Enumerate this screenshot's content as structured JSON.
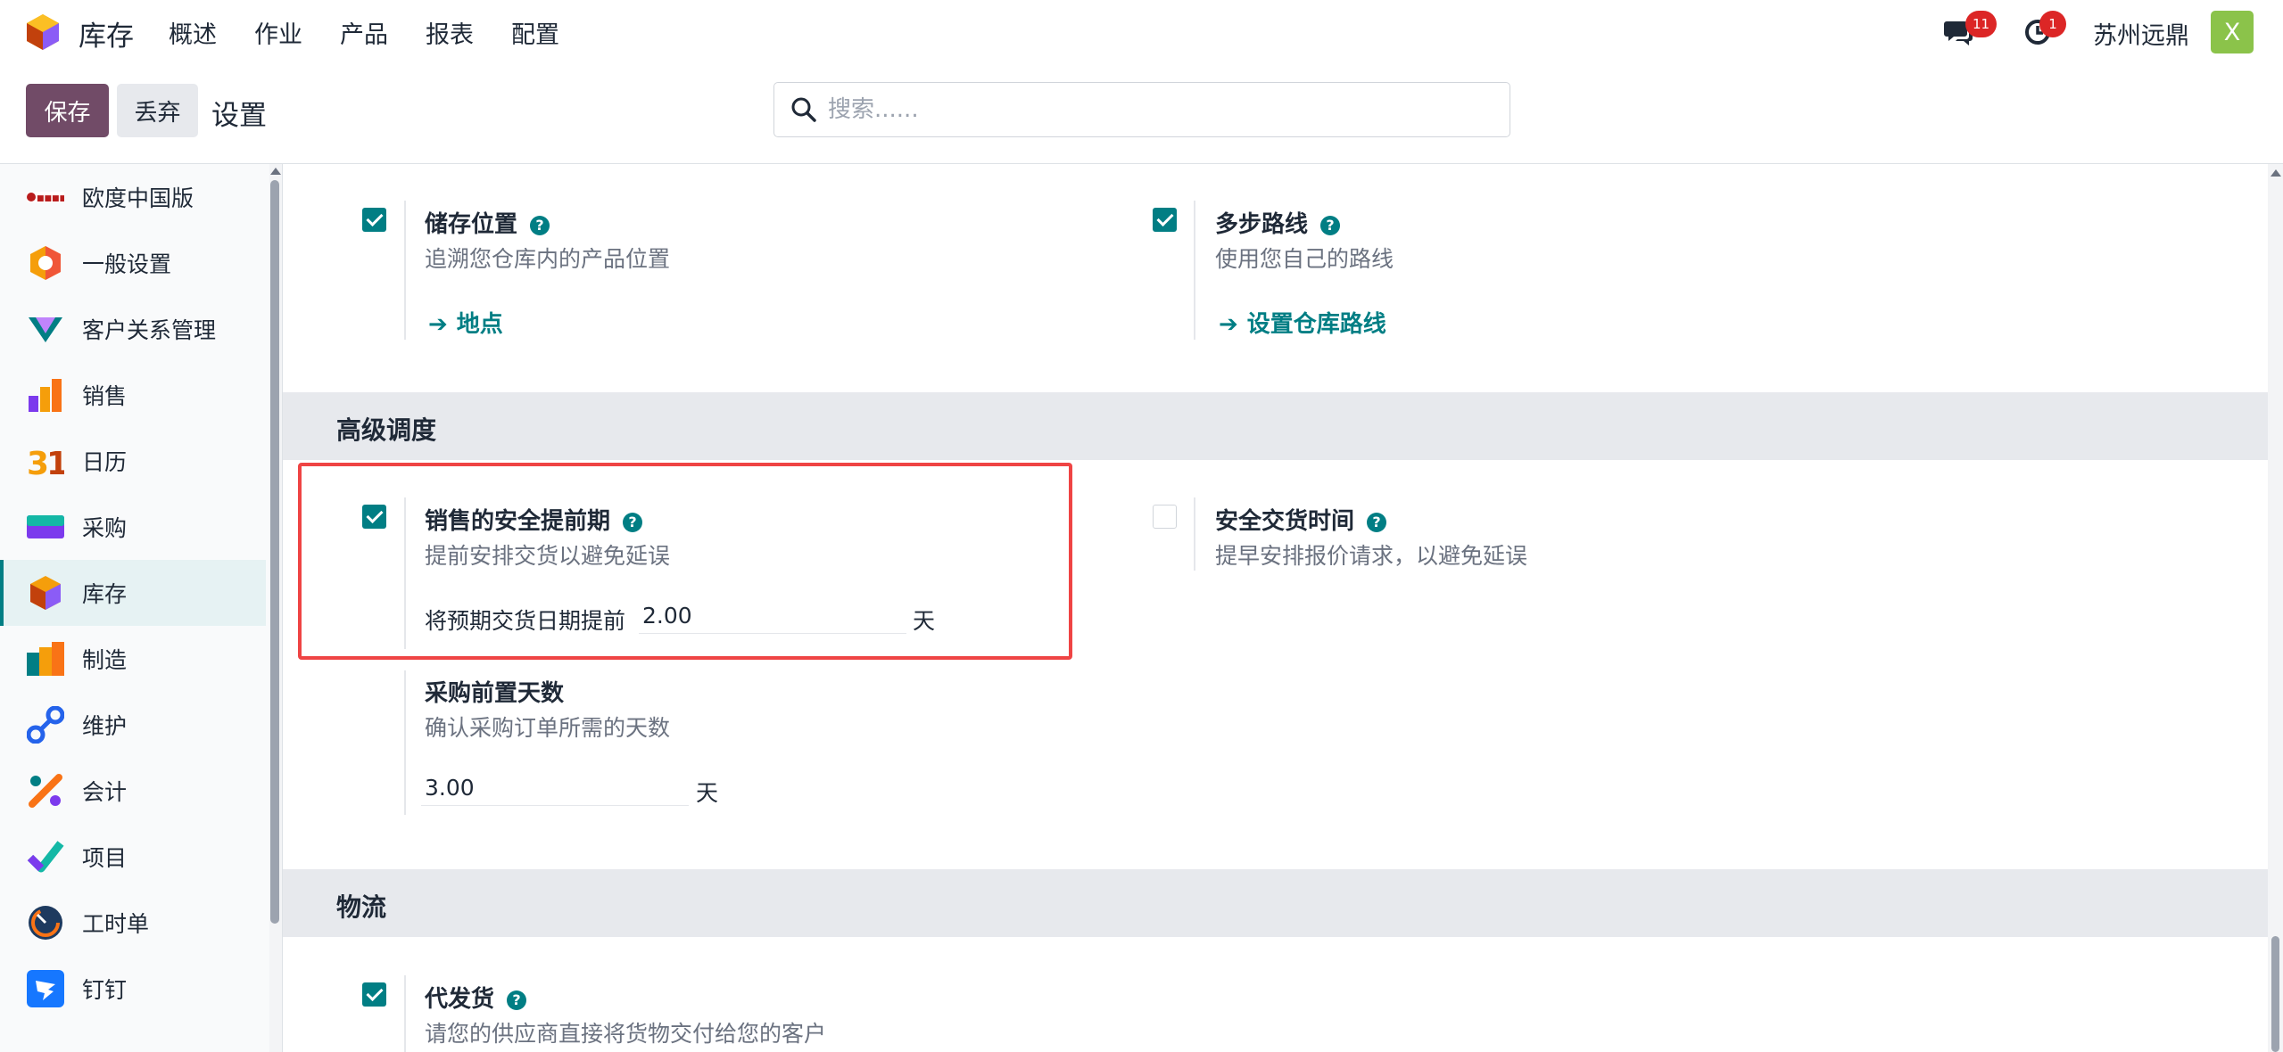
{
  "navbar": {
    "app_name": "库存",
    "menu": [
      "概述",
      "作业",
      "产品",
      "报表",
      "配置"
    ],
    "chat_badge": "11",
    "activity_badge": "1",
    "company": "苏州远鼎",
    "avatar_letter": "X"
  },
  "control": {
    "save_label": "保存",
    "discard_label": "丢弃",
    "title": "设置",
    "search_placeholder": "搜索......"
  },
  "sidebar": {
    "items": [
      {
        "label": "欧度中国版",
        "icon": "odoo-china-logo-icon"
      },
      {
        "label": "一般设置",
        "icon": "general-settings-icon"
      },
      {
        "label": "客户关系管理",
        "icon": "crm-icon"
      },
      {
        "label": "销售",
        "icon": "sales-icon"
      },
      {
        "label": "日历",
        "icon": "calendar-icon"
      },
      {
        "label": "采购",
        "icon": "purchase-icon"
      },
      {
        "label": "库存",
        "icon": "inventory-icon",
        "active": true
      },
      {
        "label": "制造",
        "icon": "manufacturing-icon"
      },
      {
        "label": "维护",
        "icon": "maintenance-icon"
      },
      {
        "label": "会计",
        "icon": "accounting-icon"
      },
      {
        "label": "项目",
        "icon": "project-icon"
      },
      {
        "label": "工时单",
        "icon": "timesheet-icon"
      },
      {
        "label": "钉钉",
        "icon": "dingtalk-icon"
      }
    ]
  },
  "settings": {
    "storage_locations": {
      "title": "储存位置",
      "desc": "追溯您仓库内的产品位置",
      "link": "地点",
      "checked": true
    },
    "multi_step_routes": {
      "title": "多步路线",
      "desc": "使用您自己的路线",
      "link": "设置仓库路线",
      "checked": true
    },
    "advanced_scheduling": {
      "header": "高级调度"
    },
    "sales_security_lead": {
      "title": "销售的安全提前期",
      "desc": "提前安排交货以避免延误",
      "field_label": "将预期交货日期提前",
      "value": "2.00",
      "unit": "天",
      "checked": true
    },
    "security_delivery_time": {
      "title": "安全交货时间",
      "desc": "提早安排报价请求，以避免延误",
      "checked": false
    },
    "purchase_lead_days": {
      "title": "采购前置天数",
      "desc": "确认采购订单所需的天数",
      "value": "3.00",
      "unit": "天"
    },
    "logistics": {
      "header": "物流"
    },
    "dropship": {
      "title": "代发货",
      "desc": "请您的供应商直接将货物交付给您的客户",
      "checked": true
    }
  },
  "colors": {
    "primary": "#714b67",
    "teal": "#017e84",
    "highlight": "#ef4444",
    "badge": "#dc2626"
  }
}
